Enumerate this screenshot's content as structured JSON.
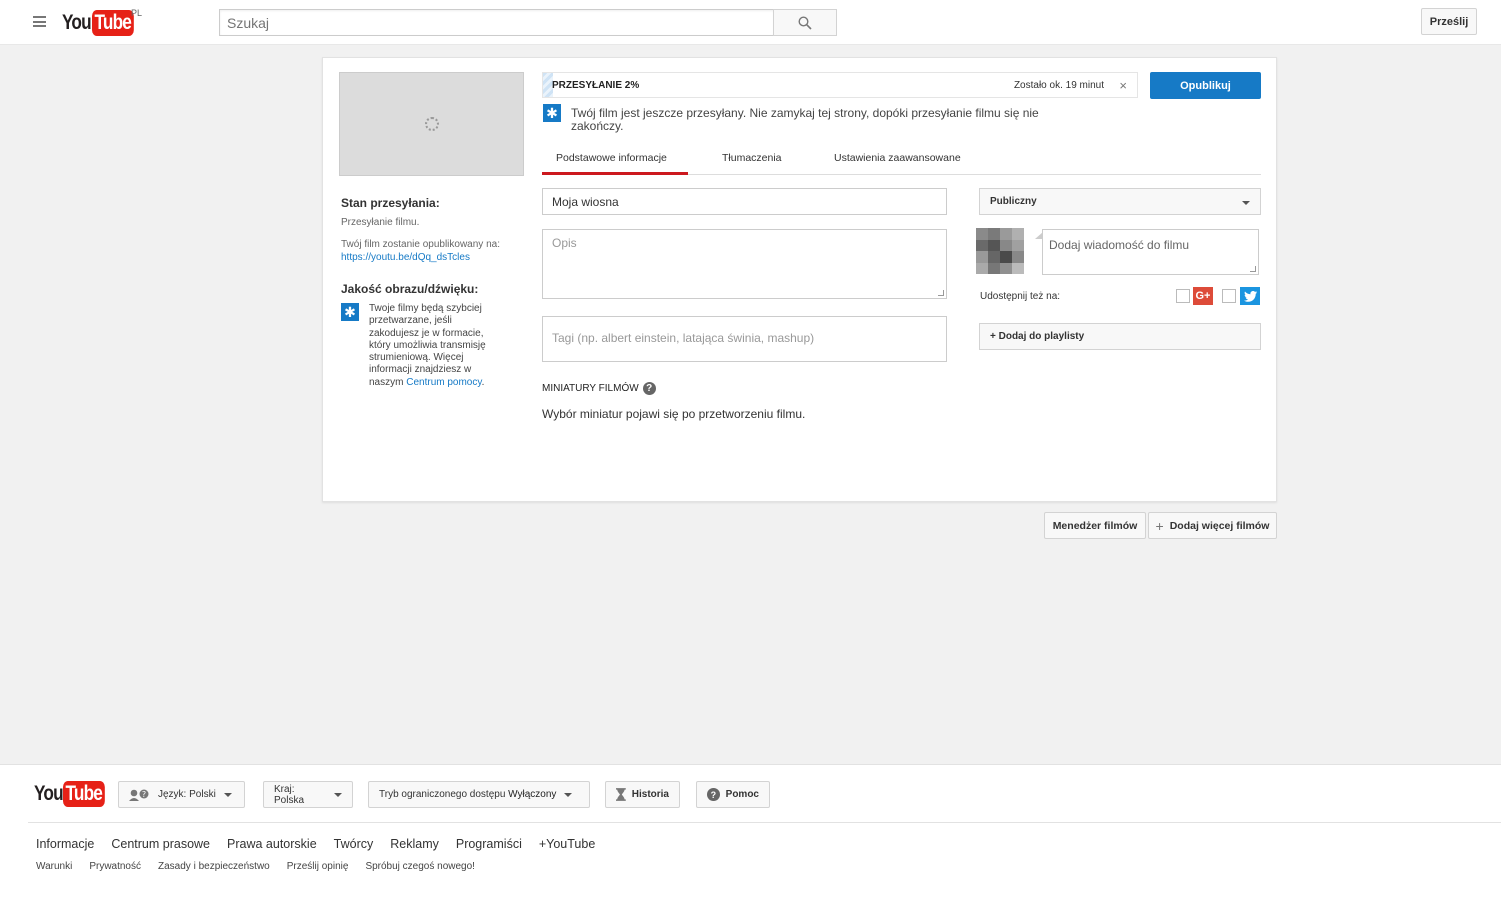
{
  "header": {
    "logo_you": "You",
    "logo_tube": "Tube",
    "region": "PL",
    "search_placeholder": "Szukaj",
    "upload_label": "Prześlij"
  },
  "upload": {
    "progress_label": "PRZESYŁANIE 2%",
    "progress_percent": 2,
    "time_left": "Zostało ok. 19 minut",
    "close_symbol": "×",
    "publish_label": "Opublikuj",
    "notice": "Twój film jest jeszcze przesyłany. Nie zamykaj tej strony, dopóki przesyłanie filmu się nie zakończy."
  },
  "left_panel": {
    "status_title": "Stan przesyłania:",
    "status_text": "Przesyłanie filmu.",
    "publish_info": "Twój film zostanie opublikowany na:",
    "video_link": "https://youtu.be/dQq_dsTcles",
    "quality_title": "Jakość obrazu/dźwięku:",
    "tip_text": "Twoje filmy będą szybciej przetwarzane, jeśli zakodujesz je w formacie, który umożliwia transmisję strumieniową. Więcej informacji znajdziesz w naszym",
    "tip_link": "Centrum pomocy",
    "tip_end": "."
  },
  "tabs": [
    {
      "label": "Podstawowe informacje",
      "active": true
    },
    {
      "label": "Tłumaczenia",
      "active": false
    },
    {
      "label": "Ustawienia zaawansowane",
      "active": false
    }
  ],
  "form": {
    "title_value": "Moja wiosna",
    "description_placeholder": "Opis",
    "tags_placeholder": "Tagi (np. albert einstein, latająca świnia, mashup)",
    "thumbnails_title": "MINIATURY FILMÓW",
    "thumbnails_text": "Wybór miniatur pojawi się po przetworzeniu filmu.",
    "privacy_value": "Publiczny",
    "message_placeholder": "Dodaj wiadomość do filmu",
    "share_label": "Udostępnij też na:",
    "playlist_label": "+ Dodaj do playlisty"
  },
  "actions": {
    "video_manager": "Menedżer filmów",
    "add_more": "Dodaj więcej filmów"
  },
  "footer": {
    "language": "Język: Polski",
    "country": "Kraj: Polska",
    "restricted_prefix": "Tryb ograniczonego dostępu ",
    "restricted_value": "Wyłączony",
    "history": "Historia",
    "help": "Pomoc",
    "links_primary": [
      "Informacje",
      "Centrum prasowe",
      "Prawa autorskie",
      "Twórcy",
      "Reklamy",
      "Programiści",
      "+YouTube"
    ],
    "links_secondary": [
      "Warunki",
      "Prywatność",
      "Zasady i bezpieczeństwo",
      "Prześlij opinię",
      "Spróbuj czegoś nowego!"
    ]
  },
  "colors": {
    "brand_red": "#e62117",
    "primary_blue": "#167ac6",
    "tab_active": "#cc181e"
  }
}
